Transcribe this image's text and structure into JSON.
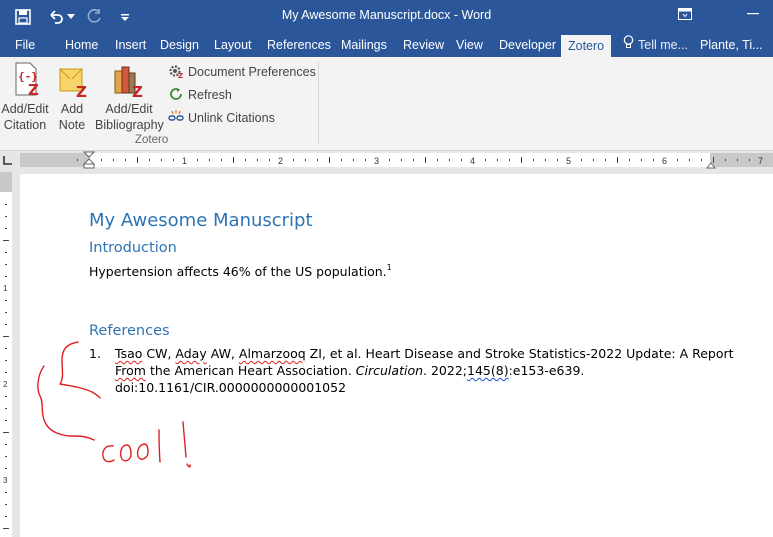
{
  "window": {
    "title": "My Awesome Manuscript.docx - Word",
    "accent": "#2b579a"
  },
  "quick_access": {
    "icons": [
      "save-icon",
      "undo-icon",
      "undo-dropdown-icon",
      "redo-icon",
      "customize-qat-icon"
    ]
  },
  "tabs": [
    {
      "label": "File"
    },
    {
      "label": "Home"
    },
    {
      "label": "Insert"
    },
    {
      "label": "Design"
    },
    {
      "label": "Layout"
    },
    {
      "label": "References"
    },
    {
      "label": "Mailings"
    },
    {
      "label": "Review"
    },
    {
      "label": "View"
    },
    {
      "label": "Developer"
    },
    {
      "label": "Zotero",
      "active": true
    }
  ],
  "tell_me": "Tell me...",
  "user": "Plante, Ti...",
  "ribbon": {
    "add_edit_citation": {
      "line1": "Add/Edit",
      "line2": "Citation"
    },
    "add_note": {
      "line1": "Add",
      "line2": "Note"
    },
    "add_edit_bibliography": {
      "line1": "Add/Edit",
      "line2": "Bibliography"
    },
    "document_preferences": "Document Preferences",
    "refresh": "Refresh",
    "unlink_citations": "Unlink Citations",
    "group_label": "Zotero"
  },
  "ruler": {
    "numbers": [
      "1",
      "2",
      "3",
      "4",
      "5",
      "6",
      "7"
    ]
  },
  "vruler": {
    "numbers": [
      "1",
      "2",
      "3"
    ]
  },
  "document": {
    "title": "My Awesome Manuscript",
    "intro_heading": "Introduction",
    "intro_text": "Hypertension affects 46% of the US population.",
    "intro_sup": "1",
    "references_heading": "References",
    "reference": {
      "number": "1.",
      "line1_a": "Tsao",
      "line1_b": " CW, ",
      "line1_c": "Aday",
      "line1_d": " AW, ",
      "line1_e": "Almarzooq",
      "line1_f": " ZI, et al. Heart Disease and Stroke Statistics-2022 Update: A Report",
      "line2_a": "From",
      "line2_b": " the American Heart Association. ",
      "line2_c": "Circulation",
      "line2_d": ". 2022;",
      "line2_e": "145(8)",
      "line2_f": ":e153-e639.",
      "line3": "doi:10.1161/CIR.0000000000001052"
    }
  },
  "annotation": {
    "ink_text": "cool!",
    "ink_color": "#e02020"
  }
}
